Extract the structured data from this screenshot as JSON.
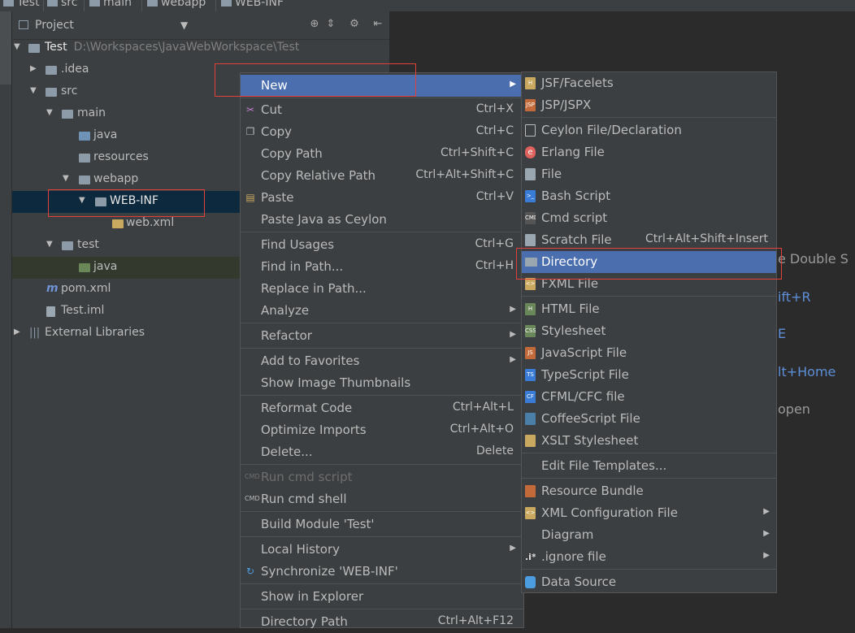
{
  "breadcrumb": [
    "Test",
    "src",
    "main",
    "webapp",
    "WEB-INF"
  ],
  "panel": {
    "title": "Project"
  },
  "tree": [
    {
      "label": "Test",
      "path": "D:\\Workspaces\\JavaWebWorkspace\\Test"
    },
    {
      "label": ".idea"
    },
    {
      "label": "src"
    },
    {
      "label": "main"
    },
    {
      "label": "java"
    },
    {
      "label": "resources"
    },
    {
      "label": "webapp"
    },
    {
      "label": "WEB-INF"
    },
    {
      "label": "web.xml"
    },
    {
      "label": "test"
    },
    {
      "label": "java"
    },
    {
      "label": "pom.xml"
    },
    {
      "label": "Test.iml"
    },
    {
      "label": "External Libraries"
    }
  ],
  "context_menu": [
    {
      "label": "New",
      "shortcut": ""
    },
    {
      "label": "Cut",
      "shortcut": "Ctrl+X"
    },
    {
      "label": "Copy",
      "shortcut": "Ctrl+C"
    },
    {
      "label": "Copy Path",
      "shortcut": "Ctrl+Shift+C"
    },
    {
      "label": "Copy Relative Path",
      "shortcut": "Ctrl+Alt+Shift+C"
    },
    {
      "label": "Paste",
      "shortcut": "Ctrl+V"
    },
    {
      "label": "Paste Java as Ceylon",
      "shortcut": ""
    },
    {
      "label": "Find Usages",
      "shortcut": "Ctrl+G"
    },
    {
      "label": "Find in Path...",
      "shortcut": "Ctrl+H"
    },
    {
      "label": "Replace in Path...",
      "shortcut": ""
    },
    {
      "label": "Analyze",
      "shortcut": ""
    },
    {
      "label": "Refactor",
      "shortcut": ""
    },
    {
      "label": "Add to Favorites",
      "shortcut": ""
    },
    {
      "label": "Show Image Thumbnails",
      "shortcut": ""
    },
    {
      "label": "Reformat Code",
      "shortcut": "Ctrl+Alt+L"
    },
    {
      "label": "Optimize Imports",
      "shortcut": "Ctrl+Alt+O"
    },
    {
      "label": "Delete...",
      "shortcut": "Delete"
    },
    {
      "label": "Run cmd script",
      "shortcut": ""
    },
    {
      "label": "Run cmd shell",
      "shortcut": ""
    },
    {
      "label": "Build Module 'Test'",
      "shortcut": ""
    },
    {
      "label": "Local History",
      "shortcut": ""
    },
    {
      "label": "Synchronize 'WEB-INF'",
      "shortcut": ""
    },
    {
      "label": "Show in Explorer",
      "shortcut": ""
    },
    {
      "label": "Directory Path",
      "shortcut": "Ctrl+Alt+F12"
    }
  ],
  "new_submenu": [
    {
      "label": "JSF/Facelets",
      "shortcut": "",
      "icon_text": "H"
    },
    {
      "label": "JSP/JSPX",
      "shortcut": "",
      "icon_text": "JSP"
    },
    {
      "label": "Ceylon File/Declaration",
      "shortcut": "",
      "icon_text": ""
    },
    {
      "label": "Erlang File",
      "shortcut": "",
      "icon_text": "e"
    },
    {
      "label": "File",
      "shortcut": "",
      "icon_text": ""
    },
    {
      "label": "Bash Script",
      "shortcut": "",
      "icon_text": ">_"
    },
    {
      "label": "Cmd script",
      "shortcut": "",
      "icon_text": "CMD"
    },
    {
      "label": "Scratch File",
      "shortcut": "Ctrl+Alt+Shift+Insert",
      "icon_text": ""
    },
    {
      "label": "Directory",
      "shortcut": "",
      "icon_text": ""
    },
    {
      "label": "FXML File",
      "shortcut": "",
      "icon_text": "<>"
    },
    {
      "label": "HTML File",
      "shortcut": "",
      "icon_text": "H"
    },
    {
      "label": "Stylesheet",
      "shortcut": "",
      "icon_text": "CSS"
    },
    {
      "label": "JavaScript File",
      "shortcut": "",
      "icon_text": "JS"
    },
    {
      "label": "TypeScript File",
      "shortcut": "",
      "icon_text": "TS"
    },
    {
      "label": "CFML/CFC file",
      "shortcut": "",
      "icon_text": "CF"
    },
    {
      "label": "CoffeeScript File",
      "shortcut": "",
      "icon_text": ""
    },
    {
      "label": "XSLT Stylesheet",
      "shortcut": "",
      "icon_text": ""
    },
    {
      "label": "Edit File Templates...",
      "shortcut": "",
      "icon_text": ""
    },
    {
      "label": "Resource Bundle",
      "shortcut": "",
      "icon_text": ""
    },
    {
      "label": "XML Configuration File",
      "shortcut": "",
      "icon_text": "<>"
    },
    {
      "label": "Diagram",
      "shortcut": "",
      "icon_text": ""
    },
    {
      "label": ".ignore file",
      "shortcut": "",
      "icon_text": ".i*"
    },
    {
      "label": "Data Source",
      "shortcut": "",
      "icon_text": ""
    }
  ],
  "editor_hints": [
    "e  Double S",
    "ift+R",
    "E",
    "lt+Home",
    "open"
  ],
  "colors": {
    "highlight": "#4b6eaf",
    "selection": "#0d293e",
    "annotation": "#e2403b",
    "hint": "#5d8fd8"
  }
}
